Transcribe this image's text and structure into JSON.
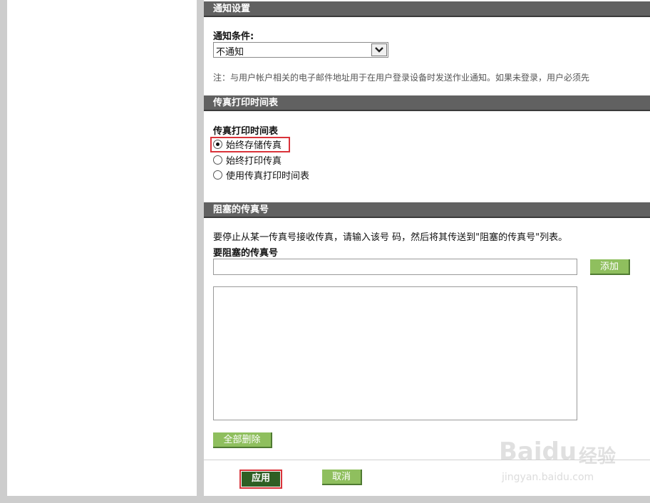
{
  "notification": {
    "header": "通知设置",
    "condition_label": "通知条件:",
    "selected": "不通知",
    "note": "注：与用户帐户相关的电子邮件地址用于在用户登录设备时发送作业通知。如果未登录，用户必须先"
  },
  "fax_print_schedule": {
    "header": "传真打印时间表",
    "label": "传真打印时间表",
    "options": [
      {
        "label": "始终存储传真",
        "checked": true
      },
      {
        "label": "始终打印传真",
        "checked": false
      },
      {
        "label": "使用传真打印时间表",
        "checked": false
      }
    ]
  },
  "blocked_fax": {
    "header": "阻塞的传真号",
    "instruction": "要停止从某一传真号接收传真，请输入该号 码，然后将其传送到\"阻塞的传真号\"列表。",
    "field_label": "要阻塞的传真号",
    "input_value": "",
    "add_label": "添加",
    "delete_all_label": "全部删除"
  },
  "footer": {
    "apply_label": "应用",
    "cancel_label": "取消"
  },
  "watermark": {
    "logo_text": "Baidu",
    "cn_text": "经验",
    "url": "jingyan.baidu.com"
  }
}
